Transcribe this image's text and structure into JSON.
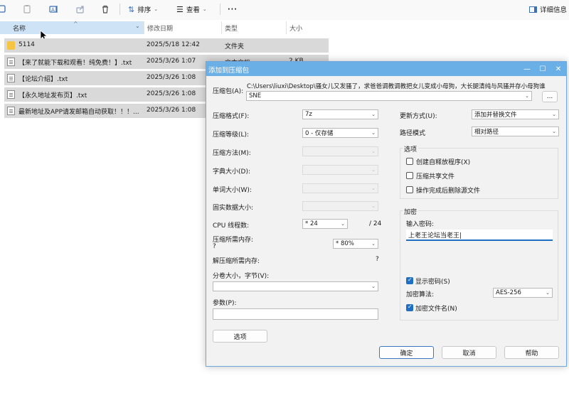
{
  "toolbar": {
    "sort_label": "排序",
    "view_label": "查看",
    "more_label": "···",
    "details_label": "详细信息",
    "icons": [
      "copy-icon",
      "paste-icon",
      "rename-icon",
      "share-icon",
      "delete-icon",
      "sort-icon",
      "view-icon",
      "details-pane-icon"
    ]
  },
  "columns": {
    "name": "名称",
    "date": "修改日期",
    "type": "类型",
    "size": "大小"
  },
  "files": [
    {
      "name": "5114",
      "date": "2025/5/18 12:42",
      "type": "文件夹",
      "size": ""
    },
    {
      "name": "【来了就能下载和观看！纯免费！】.txt",
      "date": "2025/3/26 1:07",
      "type": "文本文档",
      "size": "2 KB"
    },
    {
      "name": "【论坛介绍】.txt",
      "date": "2025/3/26 1:08",
      "type": "",
      "size": ""
    },
    {
      "name": "【永久地址发布页】.txt",
      "date": "2025/3/26 1:08",
      "type": "",
      "size": ""
    },
    {
      "name": "最新地址及APP请发邮箱自动获取！！！...",
      "date": "2025/3/26 1:08",
      "type": "",
      "size": ""
    }
  ],
  "dialog": {
    "title": "添加到压缩包",
    "archive_label": "压缩包(A):",
    "archive_path": "C:\\Users\\liuxi\\Desktop\\骚女儿又发骚了，求爸爸调教调教把女儿变成小母狗，大长腿清纯与风骚并存小母狗谁",
    "archive_name": "SNE",
    "browse_label": "...",
    "format_label": "压缩格式(F):",
    "format_value": "7z",
    "level_label": "压缩等级(L):",
    "level_value": "0 - 仅存储",
    "method_label": "压缩方法(M):",
    "dict_label": "字典大小(D):",
    "word_label": "单词大小(W):",
    "solid_label": "固实数据大小:",
    "cpu_label": "CPU 线程数:",
    "cpu_value": "* 24",
    "cpu_total": "/ 24",
    "mem_comp_label": "压缩所需内存:",
    "mem_comp_q": "?",
    "mem_comp_value": "* 80%",
    "mem_decomp_label": "解压缩所需内存:",
    "mem_decomp_q": "?",
    "split_label": "分卷大小，字节(V):",
    "params_label": "参数(P):",
    "options_button": "选项",
    "update_label": "更新方式(U):",
    "update_value": "添加并替换文件",
    "path_label": "路径模式",
    "path_value": "相对路径",
    "opts_group": "选项",
    "opt_sfx": "创建自释放程序(X)",
    "opt_shared": "压缩共享文件",
    "opt_delete": "操作完成后删除源文件",
    "enc_group": "加密",
    "enc_pwd_label": "输入密码:",
    "enc_pwd_value": "上老王论坛当老王|",
    "show_pwd": "显示密码(S)",
    "enc_method_label": "加密算法:",
    "enc_method_value": "AES-256",
    "enc_names": "加密文件名(N)",
    "ok": "确定",
    "cancel": "取消",
    "help": "帮助"
  }
}
